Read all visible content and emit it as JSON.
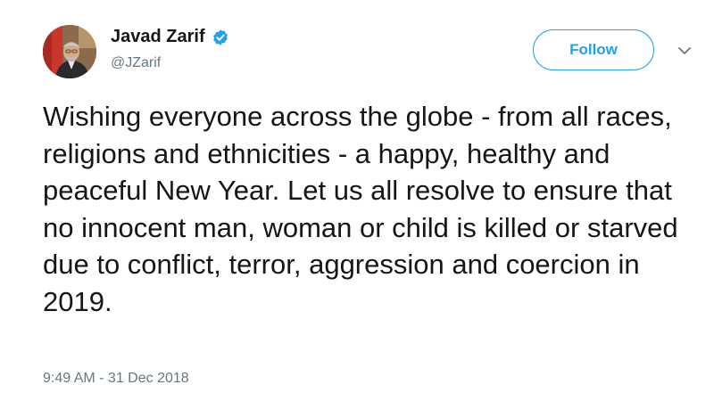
{
  "user": {
    "display_name": "Javad Zarif",
    "handle": "@JZarif",
    "verified_icon": "verified-badge-icon"
  },
  "actions": {
    "follow_label": "Follow",
    "more_icon": "chevron-down-icon"
  },
  "tweet": {
    "text": "Wishing everyone across the globe - from all races, religions and ethnicities - a happy, healthy and peaceful New Year. Let us all resolve to ensure that no innocent man, woman or child is killed or starved due to conflict, terror, aggression and coercion in 2019.",
    "timestamp": "9:49 AM - 31 Dec 2018"
  },
  "colors": {
    "accent": "#1da1f2",
    "text_primary": "#14171a",
    "text_secondary": "#657786"
  }
}
